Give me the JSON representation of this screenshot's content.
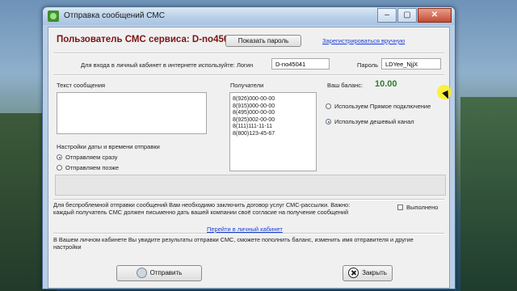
{
  "window": {
    "title": "Отправка сообщений СМС",
    "controls": [
      "–",
      "▢",
      "✕"
    ]
  },
  "header": {
    "user_label": "Пользователь СМС сервиса: D-no45041",
    "show_password_button": "Показать пароль",
    "register_link": "Зарегистрироваться вручную"
  },
  "login": {
    "hint": "Для входа в личный кабинет в интернете используйте: Логин",
    "login_value": "D-no45041",
    "password_label": "Пароль",
    "password_value": "LDYee_NjjX"
  },
  "message": {
    "label": "Текст сообщения",
    "value": ""
  },
  "recipients": {
    "label": "Получатели",
    "items": [
      "8(926)000-00-00",
      "8(915)000-00-00",
      "8(495)000-00-00",
      "8(925)002-00-00",
      "8(111)111-11-11",
      "8(800)123-45-67"
    ]
  },
  "balance": {
    "label": "Ваш баланс:",
    "value": "10.00"
  },
  "connection": {
    "direct": "Используем Прямое подключение",
    "cheap": "Используем дешевый канал",
    "selected": "cheap"
  },
  "schedule": {
    "label": "Настройки даты и времени отправки",
    "send_now": "Отправляем сразу",
    "send_later": "Отправляем позже",
    "selected": "send_now"
  },
  "info": {
    "contract_text": "Для беспроблемной отправки сообщений Вам необходимо заключить договор услуг СМС-рассылки. Важно: каждый получатель СМС должен письменно дать вашей компании своё согласие  на получение сообщений",
    "done_label": "Выполнено",
    "cabinet_link": "Перейти в личный кабинет",
    "cabinet_text": "В Вашем личном кабинете Вы увидите результаты отправки СМС, сможете пополнить баланс, изменить имя отправителя и другие настройки"
  },
  "footer": {
    "send_button": "Отправить",
    "close_button": "Закрыть"
  },
  "colors": {
    "user_title": "#7a1414",
    "balance": "#2d7f2d",
    "link": "#1a3fd4"
  }
}
